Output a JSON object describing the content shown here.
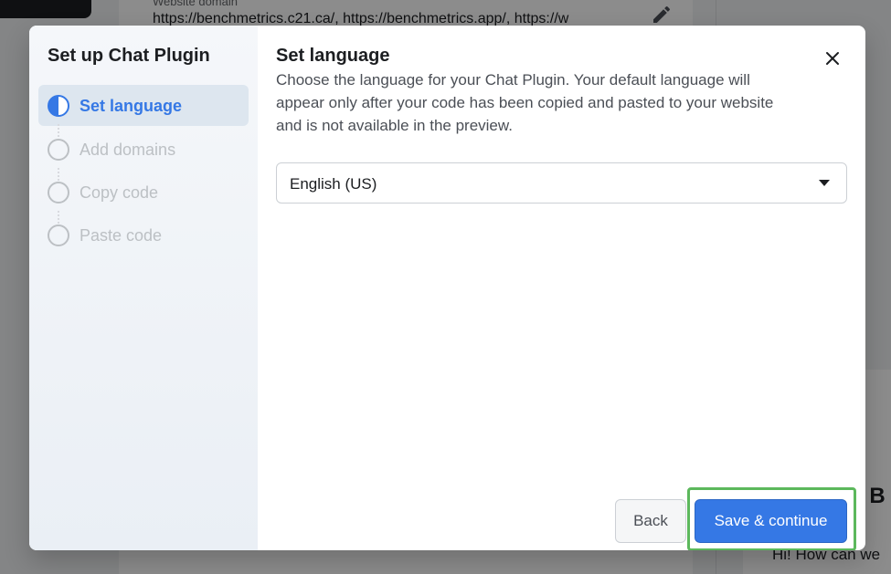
{
  "background": {
    "domain_label": "Website domain",
    "domain_value": "https://benchmetrics.c21.ca/, https://benchmetrics.app/, https://w",
    "edit_icon": "pencil-icon",
    "preview_heading": "n B",
    "preview_greeting": "Hi! How can we"
  },
  "modal": {
    "sidebar_title": "Set up Chat Plugin",
    "steps": [
      {
        "label": "Set language",
        "state": "active"
      },
      {
        "label": "Add domains",
        "state": "pending"
      },
      {
        "label": "Copy code",
        "state": "pending"
      },
      {
        "label": "Paste code",
        "state": "pending"
      }
    ],
    "content_title": "Set language",
    "content_description": "Choose the language for your Chat Plugin. Your default language will appear only after your code has been copied and pasted to your website and is not available in the preview.",
    "close_icon": "close-icon",
    "language_select": {
      "value": "English (US)",
      "icon": "caret-down-icon"
    },
    "back_label": "Back",
    "save_label": "Save & continue"
  },
  "colors": {
    "accent": "#3578e5",
    "highlight": "#5cb85c",
    "overlay": "rgba(0,0,0,0.45)"
  }
}
